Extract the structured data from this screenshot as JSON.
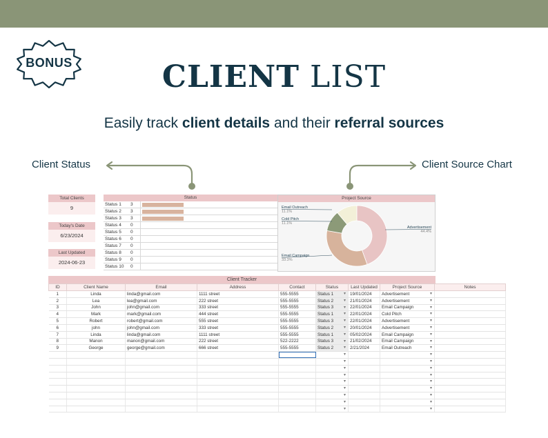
{
  "badge": {
    "label": "BONUS"
  },
  "title": {
    "bold": "CLIENT",
    "light": "LIST"
  },
  "subtitle": {
    "part1": "Easily track ",
    "bold1": "client details",
    "part2": " and their ",
    "bold2": "referral sources"
  },
  "callouts": {
    "left": "Client Status",
    "right": "Client Source Chart"
  },
  "colors": {
    "topbar": "#8a9577",
    "accent": "#8a9577",
    "navy": "#143545",
    "pink_header": "#ecc7c9",
    "pink_light": "#fbeeee"
  },
  "kpis": [
    {
      "label": "Total Clients",
      "value": "9"
    },
    {
      "label": "Today's Date",
      "value": "6/23/2024"
    },
    {
      "label": "Last Updated",
      "value": "2024-06-23"
    }
  ],
  "status_panel": {
    "title": "Status",
    "rows": [
      {
        "label": "Status 1",
        "count": 3
      },
      {
        "label": "Status 2",
        "count": 3
      },
      {
        "label": "Status 3",
        "count": 3
      },
      {
        "label": "Status 4",
        "count": 0
      },
      {
        "label": "Status 5",
        "count": 0
      },
      {
        "label": "Status 6",
        "count": 0
      },
      {
        "label": "Status 7",
        "count": 0
      },
      {
        "label": "Status 8",
        "count": 0
      },
      {
        "label": "Status 9",
        "count": 0
      },
      {
        "label": "Status 10",
        "count": 0
      }
    ]
  },
  "chart_data": {
    "type": "pie",
    "title": "Project Source",
    "slices": [
      {
        "label": "Advertisement",
        "value": 44.4,
        "display": "44.4%",
        "color": "#e8c4c4"
      },
      {
        "label": "Email Campaign",
        "value": 33.3,
        "display": "33.3%",
        "color": "#d7b39c"
      },
      {
        "label": "Cold Pitch",
        "value": 11.1,
        "display": "11.1%",
        "color": "#8c9a78"
      },
      {
        "label": "Email Outreach",
        "value": 11.1,
        "display": "11.1%",
        "color": "#f3f0d8"
      }
    ]
  },
  "tracker": {
    "title": "Client Tracker",
    "columns": [
      "ID",
      "Client Name",
      "Email",
      "Address",
      "Contact",
      "Status",
      "Last Updated",
      "Project Source",
      "Notes"
    ],
    "rows": [
      [
        "1",
        "Linda",
        "linda@gmail.com",
        "1111 street",
        "555-5555",
        "Status 1",
        "19/01/2024",
        "Advertisement",
        ""
      ],
      [
        "2",
        "Lea",
        "lea@gmail.com",
        "222 street",
        "555-5555",
        "Status 2",
        "21/01/2024",
        "Advertisement",
        ""
      ],
      [
        "3",
        "John",
        "john@gmail.com",
        "333 street",
        "555-5555",
        "Status 3",
        "22/01/2024",
        "Email Campaign",
        ""
      ],
      [
        "4",
        "Mark",
        "mark@gmail.com",
        "444 street",
        "555-5555",
        "Status 1",
        "22/01/2024",
        "Cold Pitch",
        ""
      ],
      [
        "5",
        "Robert",
        "robert@gmail.com",
        "555 street",
        "555-5555",
        "Status 3",
        "22/01/2024",
        "Advertisement",
        ""
      ],
      [
        "6",
        "john",
        "john@gmail.com",
        "333 street",
        "555-5555",
        "Status 2",
        "20/01/2024",
        "Advertisement",
        ""
      ],
      [
        "7",
        "Linda",
        "linda@gmail.com",
        "1111 street",
        "555-5555",
        "Status 1",
        "05/02/2024",
        "Email Campaign",
        ""
      ],
      [
        "8",
        "Manon",
        "manon@gmail.com",
        "222 street",
        "522-2222",
        "Status 3",
        "21/02/2024",
        "Email Campaign",
        ""
      ],
      [
        "9",
        "George",
        "george@gmail.com",
        "666 street",
        "555-5555",
        "Status 2",
        "2/21/2024",
        "Email Outreach",
        ""
      ]
    ],
    "empty_rows": 9
  }
}
